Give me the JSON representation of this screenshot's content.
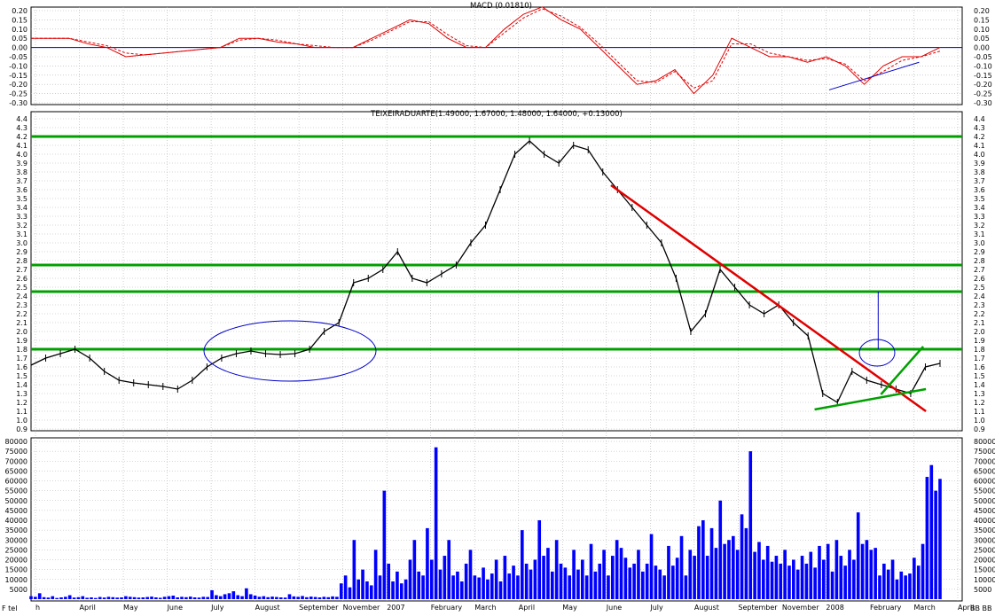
{
  "chart_data": [
    {
      "panel": "macd",
      "type": "line",
      "title": "MACD (0.01810)",
      "ylim": [
        -0.3,
        0.2
      ],
      "yticks": [
        "0.20",
        "0.15",
        "0.10",
        "0.05",
        "0.00",
        "-0.05",
        "-0.10",
        "-0.15",
        "-0.20",
        "-0.25",
        "-0.30"
      ],
      "grid": true,
      "colors": {
        "series": "#e00000",
        "signal": "#e00000",
        "zero_line": "#0000c8",
        "trend": "#0000c8"
      },
      "series": [
        {
          "style": "solid",
          "values": [
            0.05,
            0.05,
            0.05,
            0.02,
            0.0,
            -0.05,
            -0.04,
            -0.03,
            -0.02,
            -0.01,
            0.0,
            0.05,
            0.05,
            0.03,
            0.02,
            0.0,
            0.0,
            0.0,
            0.05,
            0.1,
            0.15,
            0.13,
            0.05,
            0.0,
            0.0,
            0.1,
            0.18,
            0.22,
            0.15,
            0.1,
            0.0,
            -0.1,
            -0.2,
            -0.18,
            -0.12,
            -0.25,
            -0.15,
            0.05,
            0.0,
            -0.05,
            -0.05,
            -0.08,
            -0.05,
            -0.1,
            -0.2,
            -0.1,
            -0.05,
            -0.05,
            0.0
          ]
        },
        {
          "style": "dashed",
          "values": [
            0.05,
            0.05,
            0.05,
            0.03,
            0.01,
            -0.03,
            -0.04,
            -0.03,
            -0.02,
            -0.01,
            0.0,
            0.04,
            0.05,
            0.04,
            0.02,
            0.01,
            0.0,
            0.0,
            0.04,
            0.09,
            0.14,
            0.14,
            0.07,
            0.01,
            0.0,
            0.08,
            0.16,
            0.21,
            0.17,
            0.11,
            0.02,
            -0.08,
            -0.18,
            -0.19,
            -0.13,
            -0.22,
            -0.18,
            0.02,
            0.02,
            -0.03,
            -0.05,
            -0.07,
            -0.06,
            -0.09,
            -0.18,
            -0.13,
            -0.07,
            -0.05,
            -0.02
          ]
        }
      ],
      "annotations": [
        {
          "type": "trendline",
          "from": [
            0.878,
            -0.23
          ],
          "to": [
            0.977,
            -0.08
          ]
        }
      ]
    },
    {
      "panel": "price",
      "type": "line",
      "title": "TEIXEIRADUARTE(1.49000, 1.67000, 1.48000, 1.64000, +0.13000)",
      "ylim": [
        0.9,
        4.4
      ],
      "yticks": [
        "4.4",
        "4.3",
        "4.2",
        "4.1",
        "4.0",
        "3.9",
        "3.8",
        "3.7",
        "3.6",
        "3.5",
        "3.4",
        "3.3",
        "3.2",
        "3.1",
        "3.0",
        "2.9",
        "2.8",
        "2.7",
        "2.6",
        "2.5",
        "2.4",
        "2.3",
        "2.2",
        "2.1",
        "2.0",
        "1.9",
        "1.8",
        "1.7",
        "1.6",
        "1.5",
        "1.4",
        "1.3",
        "1.2",
        "1.1",
        "1.0",
        "0.9"
      ],
      "grid": true,
      "colors": {
        "price": "#000000",
        "support": "#00a000",
        "downtrend": "#e00000",
        "marker": "#0000c8"
      },
      "series": [
        {
          "name": "",
          "values": [
            1.62,
            1.7,
            1.75,
            1.8,
            1.7,
            1.55,
            1.45,
            1.42,
            1.4,
            1.38,
            1.35,
            1.45,
            1.6,
            1.7,
            1.75,
            1.78,
            1.75,
            1.74,
            1.75,
            1.8,
            2.0,
            2.1,
            2.55,
            2.6,
            2.7,
            2.9,
            2.6,
            2.55,
            2.65,
            2.75,
            3.0,
            3.2,
            3.6,
            4.0,
            4.15,
            4.0,
            3.9,
            4.1,
            4.05,
            3.8,
            3.6,
            3.4,
            3.2,
            3.0,
            2.6,
            2.0,
            2.2,
            2.7,
            2.5,
            2.3,
            2.2,
            2.3,
            2.1,
            1.95,
            1.3,
            1.2,
            1.55,
            1.45,
            1.4,
            1.35,
            1.3,
            1.6,
            1.64
          ]
        }
      ],
      "horizontal_lines": [
        4.2,
        2.75,
        2.45,
        1.8
      ],
      "annotations": [
        {
          "type": "downtrend",
          "from": [
            0.638,
            3.65
          ],
          "to": [
            0.965,
            1.1
          ]
        },
        {
          "type": "uptrend",
          "from": [
            0.862,
            1.12
          ],
          "to": [
            0.965,
            1.35
          ]
        },
        {
          "type": "breakout",
          "from": [
            0.935,
            1.29
          ],
          "to": [
            0.962,
            1.83
          ]
        },
        {
          "type": "ellipse",
          "around": "August–November consolidation"
        },
        {
          "type": "ellipse",
          "around": "January 2008 test of trendline"
        },
        {
          "type": "measure",
          "at": 0.932,
          "from": 1.8,
          "to": 2.45
        }
      ]
    },
    {
      "panel": "volume",
      "type": "bar",
      "ylim": [
        0,
        80000
      ],
      "yticks": [
        "80000",
        "75000",
        "70000",
        "65000",
        "60000",
        "55000",
        "50000",
        "45000",
        "40000",
        "35000",
        "30000",
        "25000",
        "20000",
        "15000",
        "10000",
        "5000"
      ],
      "grid": true,
      "colors": {
        "bars": "#0000ff"
      },
      "values": [
        1500,
        1200,
        3000,
        1000,
        800,
        1500,
        600,
        900,
        1200,
        2000,
        800,
        1000,
        1500,
        700,
        900,
        600,
        1100,
        800,
        1200,
        1000,
        800,
        900,
        1500,
        1200,
        1000,
        800,
        900,
        1100,
        1300,
        900,
        700,
        1200,
        1500,
        1800,
        900,
        1200,
        1000,
        1300,
        900,
        800,
        1200,
        1100,
        4500,
        2000,
        1500,
        2500,
        3000,
        4000,
        2000,
        1500,
        5500,
        2500,
        1800,
        1200,
        1500,
        1000,
        1300,
        1100,
        900,
        800,
        2500,
        1400,
        1200,
        1600,
        1000,
        1300,
        1100,
        900,
        1200,
        1000,
        1400,
        1200,
        8000,
        12000,
        6000,
        30000,
        10000,
        15000,
        9000,
        7000,
        25000,
        12000,
        55000,
        18000,
        9000,
        14000,
        8000,
        10000,
        20000,
        30000,
        14000,
        12000,
        36000,
        20000,
        77000,
        15000,
        22000,
        30000,
        12000,
        14000,
        9000,
        18000,
        25000,
        12000,
        11000,
        16000,
        10000,
        13000,
        20000,
        9000,
        22000,
        13000,
        17000,
        12000,
        35000,
        18000,
        15000,
        20000,
        40000,
        22000,
        26000,
        14000,
        30000,
        18000,
        16000,
        12000,
        25000,
        15000,
        20000,
        12000,
        28000,
        14000,
        18000,
        25000,
        12000,
        22000,
        30000,
        26000,
        21000,
        16000,
        18000,
        25000,
        14000,
        18000,
        33000,
        17000,
        15000,
        12000,
        27000,
        17000,
        21000,
        32000,
        12000,
        25000,
        22000,
        37000,
        40000,
        22000,
        36000,
        26000,
        50000,
        28000,
        30000,
        32000,
        25000,
        43000,
        36000,
        75000,
        24000,
        29000,
        20000,
        27000,
        19000,
        22000,
        18000,
        25000,
        17000,
        20000,
        15000,
        22000,
        18000,
        24000,
        16000,
        27000,
        20000,
        28000,
        14000,
        30000,
        22000,
        17000,
        25000,
        20000,
        44000,
        28000,
        30000,
        25000,
        26000,
        12000,
        18000,
        15000,
        20000,
        10000,
        14000,
        12000,
        13000,
        21000,
        17000,
        28000,
        62000,
        68000,
        55000,
        61000
      ]
    }
  ],
  "time_axis": {
    "labels": [
      "h",
      "April",
      "May",
      "June",
      "July",
      "August",
      "September",
      "November",
      "2007",
      "February",
      "March",
      "April",
      "May",
      "June",
      "July",
      "August",
      "September",
      "November",
      "2008",
      "February",
      "March",
      "April"
    ],
    "left_legend": "F tel",
    "right_legend": "BB BB"
  }
}
